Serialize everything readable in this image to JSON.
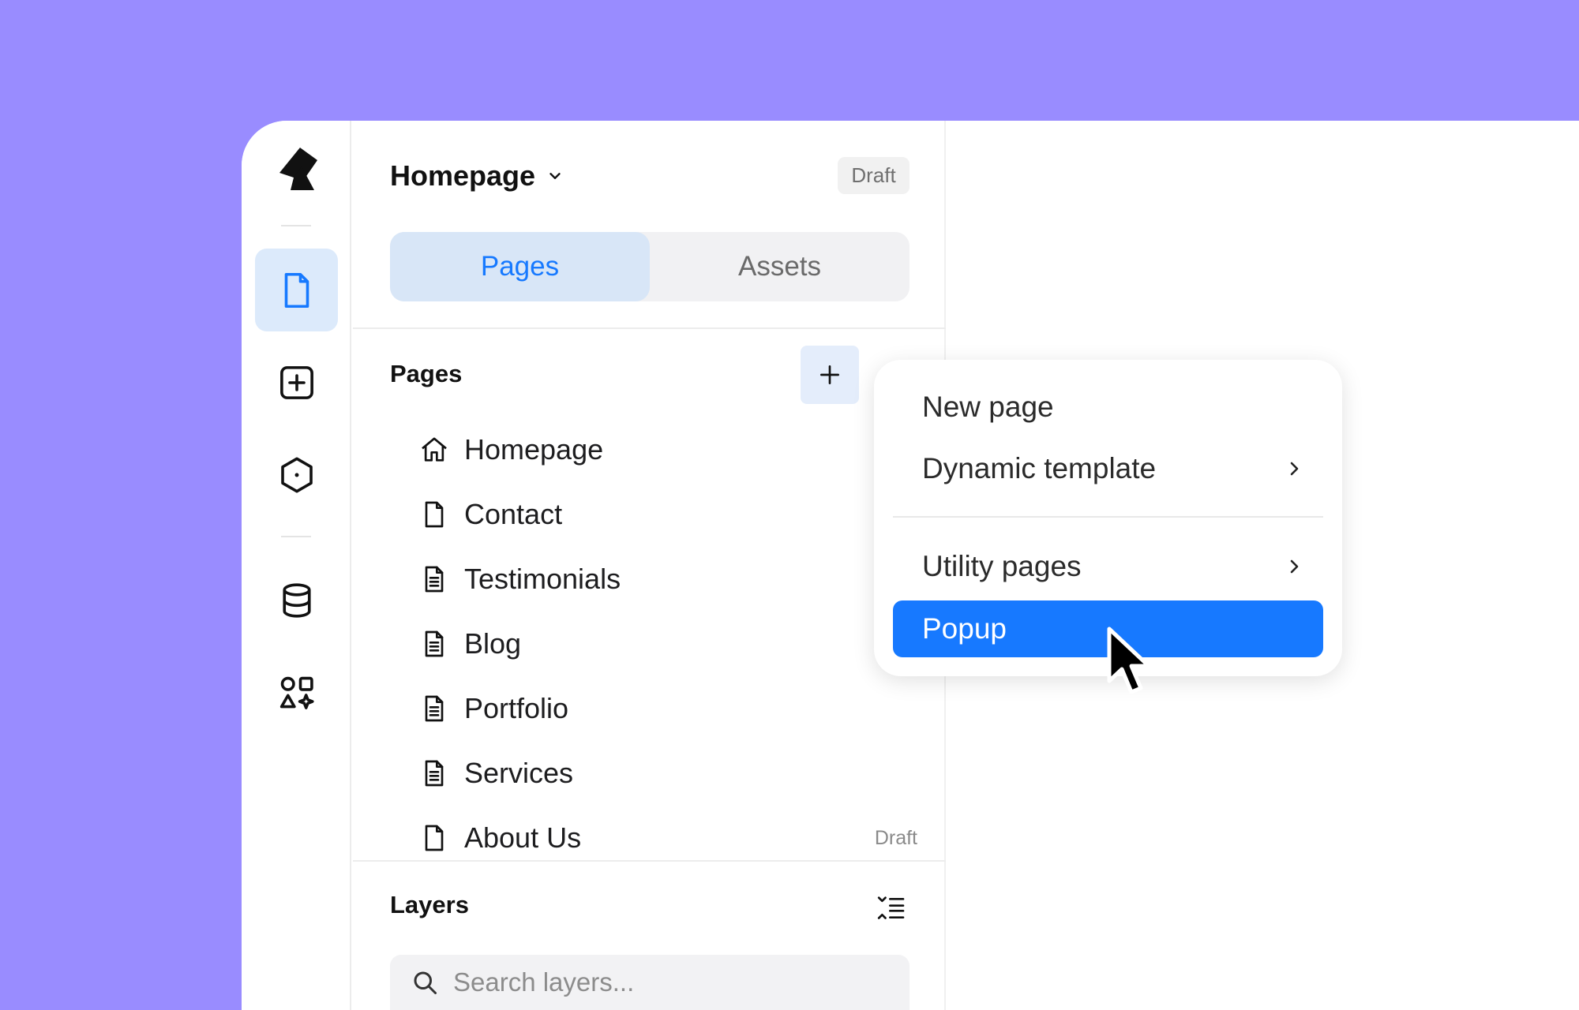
{
  "header": {
    "title": "Homepage",
    "status": "Draft"
  },
  "tabs": [
    {
      "label": "Pages",
      "active": true
    },
    {
      "label": "Assets",
      "active": false
    }
  ],
  "pages_section": {
    "title": "Pages",
    "items": [
      {
        "label": "Homepage",
        "icon": "home-icon",
        "status": ""
      },
      {
        "label": "Contact",
        "icon": "page-icon",
        "status": ""
      },
      {
        "label": "Testimonials",
        "icon": "document-icon",
        "status": ""
      },
      {
        "label": "Blog",
        "icon": "document-icon",
        "status": ""
      },
      {
        "label": "Portfolio",
        "icon": "document-icon",
        "status": ""
      },
      {
        "label": "Services",
        "icon": "document-icon",
        "status": ""
      },
      {
        "label": "About Us",
        "icon": "page-icon",
        "status": "Draft"
      }
    ]
  },
  "layers_section": {
    "title": "Layers",
    "search_placeholder": "Search layers..."
  },
  "menu": {
    "items": [
      {
        "label": "New page",
        "has_submenu": false,
        "highlighted": false
      },
      {
        "label": "Dynamic template",
        "has_submenu": true,
        "highlighted": false
      },
      {
        "label": "Utility pages",
        "has_submenu": true,
        "highlighted": false
      },
      {
        "label": "Popup",
        "has_submenu": false,
        "highlighted": true
      }
    ]
  },
  "colors": {
    "background": "#998cff",
    "canvas": "#5ccfb6",
    "accent": "#1779ff",
    "active_tab_bg": "#d8e6f7"
  }
}
